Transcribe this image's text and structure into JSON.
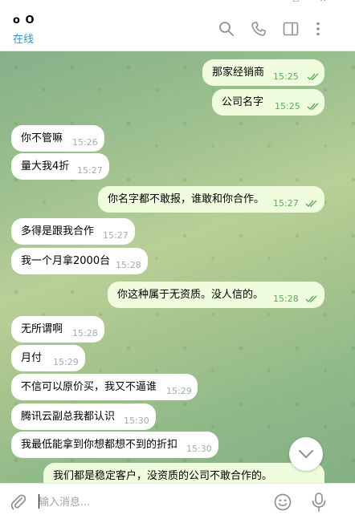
{
  "header": {
    "name": "o O",
    "status": "在线"
  },
  "composer": {
    "placeholder": "输入消息..."
  },
  "messages": [
    {
      "text": "那家经销商",
      "time": "15:25",
      "dir": "out"
    },
    {
      "text": "公司名字",
      "time": "15:25",
      "dir": "out"
    },
    {
      "text": "你不管嘛",
      "time": "15:26",
      "dir": "in"
    },
    {
      "text": "量大我4折",
      "time": "15:27",
      "dir": "in"
    },
    {
      "text": "你名字都不敢报，谁敢和你合作。",
      "time": "15:27",
      "dir": "out"
    },
    {
      "text": "多得是跟我合作",
      "time": "15:27",
      "dir": "in"
    },
    {
      "text": "我一个月拿2000台",
      "time": "15:28",
      "dir": "in"
    },
    {
      "text": "你这种属于无资质。没人信的。",
      "time": "15:28",
      "dir": "out"
    },
    {
      "text": "无所谓啊",
      "time": "15:28",
      "dir": "in"
    },
    {
      "text": "月付",
      "time": "15:29",
      "dir": "in"
    },
    {
      "text": "不信可以原价买，我又不逼谁",
      "time": "15:29",
      "dir": "in"
    },
    {
      "text": "腾讯云副总我都认识",
      "time": "15:30",
      "dir": "in"
    },
    {
      "text": "我最低能拿到你想都想不到的折扣",
      "time": "15:30",
      "dir": "in"
    },
    {
      "text": "我们都是稳定客户，没资质的公司不敢合作的。",
      "time": "",
      "dir": "out"
    }
  ]
}
